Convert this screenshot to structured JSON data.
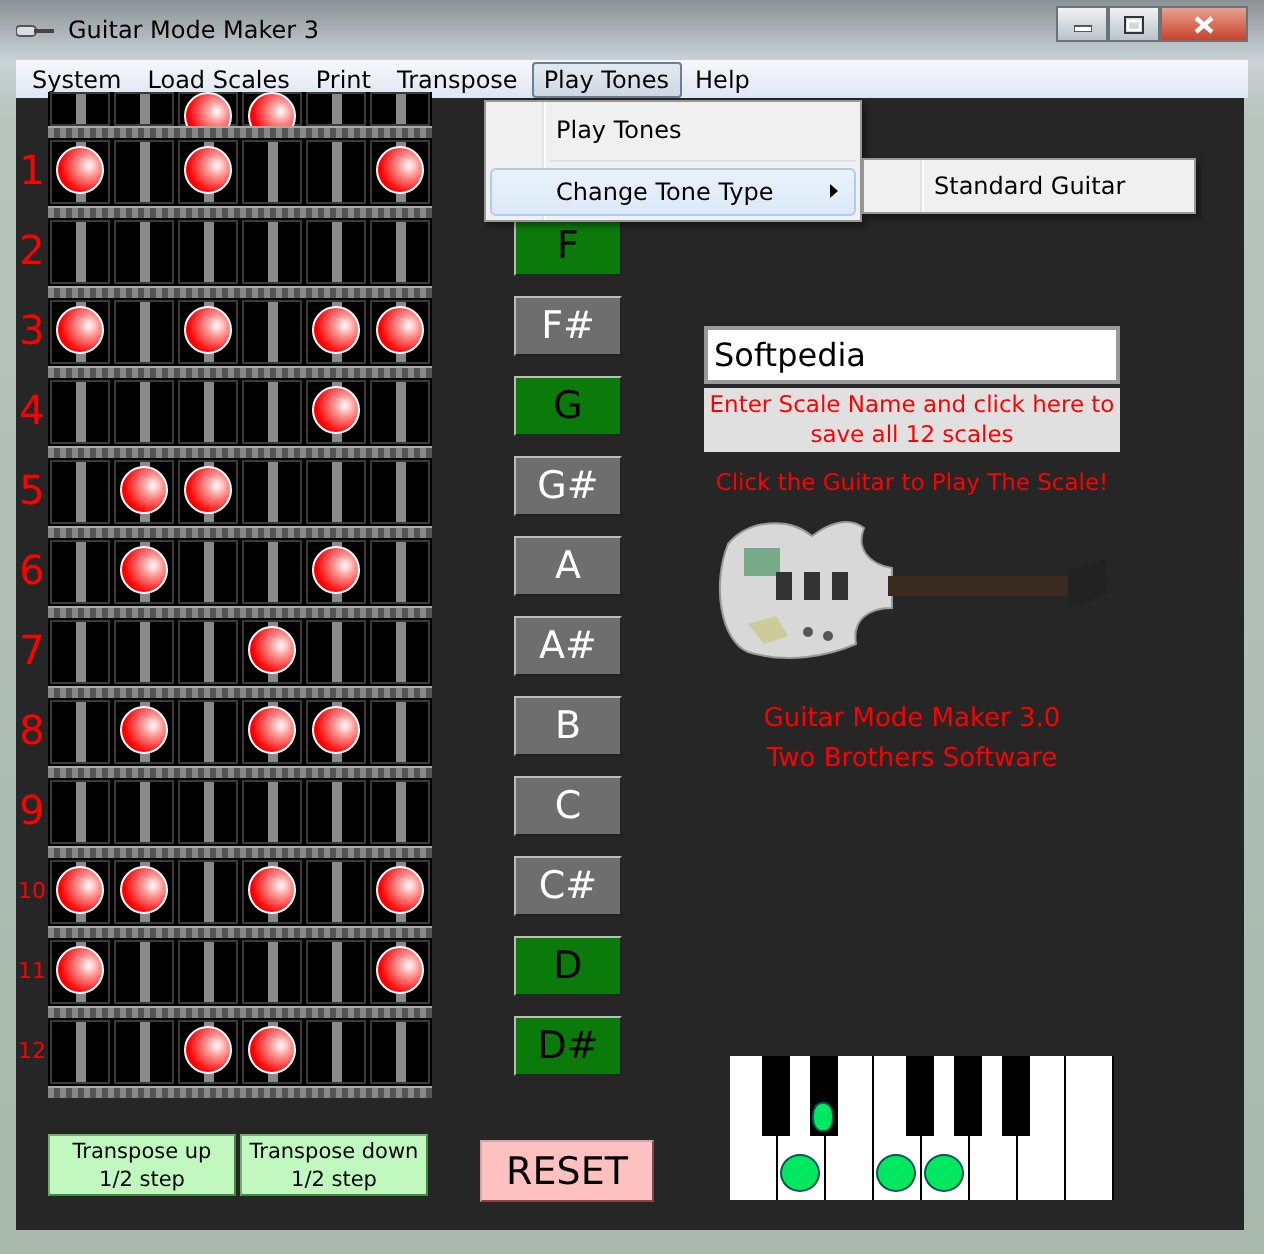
{
  "window": {
    "title": "Guitar Mode Maker 3"
  },
  "menu_bar": [
    {
      "label": "System",
      "selected": false
    },
    {
      "label": "Load Scales",
      "selected": false
    },
    {
      "label": "Print",
      "selected": false
    },
    {
      "label": "Transpose",
      "selected": false
    },
    {
      "label": "Play Tones",
      "selected": true
    },
    {
      "label": "Help",
      "selected": false
    }
  ],
  "open_menu": {
    "items": [
      {
        "label": "Play Tones",
        "kind": "item",
        "selected": false
      },
      {
        "label": "Change Tone Type",
        "kind": "submenu",
        "selected": true
      }
    ],
    "submenu": [
      {
        "label": "Standard Guitar"
      }
    ]
  },
  "fretboard": {
    "rows": [
      {
        "dots": [
          false,
          false,
          true,
          true,
          false,
          false
        ]
      },
      {
        "label": "1",
        "dots": [
          true,
          false,
          true,
          false,
          false,
          true
        ]
      },
      {
        "label": "2",
        "dots": [
          false,
          false,
          false,
          false,
          false,
          false
        ]
      },
      {
        "label": "3",
        "dots": [
          true,
          false,
          true,
          false,
          true,
          true
        ]
      },
      {
        "label": "4",
        "dots": [
          false,
          false,
          false,
          false,
          true,
          false
        ]
      },
      {
        "label": "5",
        "dots": [
          false,
          true,
          true,
          false,
          false,
          false
        ]
      },
      {
        "label": "6",
        "dots": [
          false,
          true,
          false,
          false,
          true,
          false
        ]
      },
      {
        "label": "7",
        "dots": [
          false,
          false,
          false,
          true,
          false,
          false
        ]
      },
      {
        "label": "8",
        "dots": [
          false,
          true,
          false,
          true,
          true,
          false
        ]
      },
      {
        "label": "9",
        "dots": [
          false,
          false,
          false,
          false,
          false,
          false
        ]
      },
      {
        "label": "10",
        "dots": [
          true,
          true,
          false,
          true,
          false,
          true
        ]
      },
      {
        "label": "11",
        "dots": [
          true,
          false,
          false,
          false,
          false,
          true
        ]
      },
      {
        "label": "12",
        "dots": [
          false,
          false,
          true,
          true,
          false,
          false
        ]
      }
    ]
  },
  "notes": [
    {
      "label": "F",
      "selected": true
    },
    {
      "label": "F#",
      "selected": false
    },
    {
      "label": "G",
      "selected": true
    },
    {
      "label": "G#",
      "selected": false
    },
    {
      "label": "A",
      "selected": false
    },
    {
      "label": "A#",
      "selected": false
    },
    {
      "label": "B",
      "selected": false
    },
    {
      "label": "C",
      "selected": false
    },
    {
      "label": "C#",
      "selected": false
    },
    {
      "label": "D",
      "selected": true
    },
    {
      "label": "D#",
      "selected": true
    }
  ],
  "scale_name": {
    "value": "Softpedia"
  },
  "save_button": "Enter Scale Name and click here to save all 12 scales",
  "hint": "Click the Guitar to Play The Scale!",
  "credits": [
    "Guitar Mode Maker 3.0",
    "Two Brothers Software"
  ],
  "transpose_buttons": [
    "Transpose up\n1/2 step",
    "Transpose down\n1/2 step"
  ],
  "reset_button": "RESET",
  "piano": {
    "white_keys": [
      {
        "marked": false
      },
      {
        "marked": true
      },
      {
        "marked": false
      },
      {
        "marked": true
      },
      {
        "marked": true
      },
      {
        "marked": false
      },
      {
        "marked": false
      },
      {
        "marked": false
      }
    ],
    "black_keys": [
      {
        "marked": false
      },
      {
        "marked": true
      },
      {
        "marked": false
      },
      {
        "marked": false
      },
      {
        "marked": false
      }
    ]
  }
}
